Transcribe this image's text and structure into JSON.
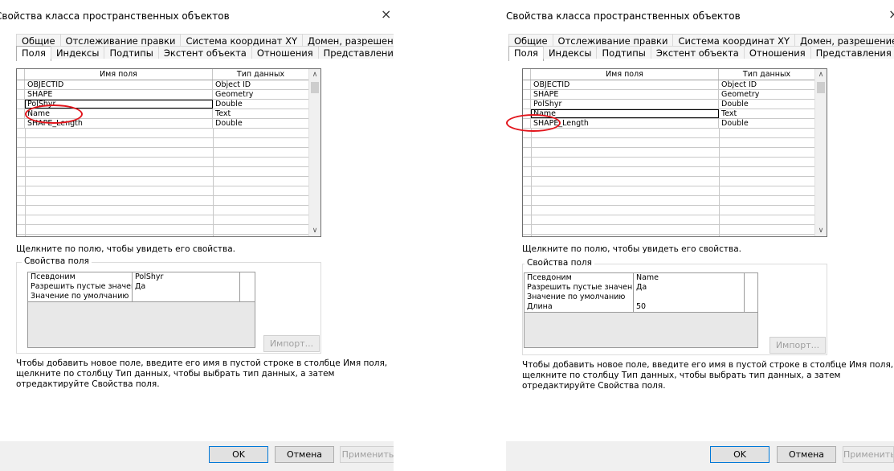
{
  "left": {
    "title": "Свойства класса пространственных объектов",
    "title_prefix_cut": "Свойства класса пространственных объектов",
    "close": "×",
    "tabs_row1": [
      "Общие",
      "Отслеживание правки",
      "Система координат XY",
      "Домен, разрешение и допуск"
    ],
    "tabs_row2": [
      "Поля",
      "Индексы",
      "Подтипы",
      "Экстент объекта",
      "Отношения",
      "Представления"
    ],
    "grid_headers": [
      "Имя поля",
      "Тип данных"
    ],
    "fields": [
      {
        "name": "OBJECTID",
        "type": "Object ID"
      },
      {
        "name": "SHAPE",
        "type": "Geometry"
      },
      {
        "name": "PolShyr",
        "type": "Double"
      },
      {
        "name": "Name",
        "type": "Text"
      },
      {
        "name": "SHAPE_Length",
        "type": "Double"
      }
    ],
    "hint": "Щелкните по полю, чтобы увидеть его свойства.",
    "group_label": "Свойства поля",
    "props": [
      {
        "k": "Псевдоним",
        "v": "PolShyr"
      },
      {
        "k": "Разрешить пустые значения",
        "v": "Да"
      },
      {
        "k": "Значение по умолчанию",
        "v": ""
      }
    ],
    "import_btn": "Импорт...",
    "instructions": [
      "Чтобы добавить новое поле, введите его имя в пустой строке в столбце Имя поля,",
      "щелкните по столбцу Тип данных, чтобы выбрать тип данных, а затем",
      "отредактируйте Свойства поля."
    ],
    "ok": "OK",
    "cancel": "Отмена",
    "apply": "Применить"
  },
  "right": {
    "title": "Свойства класса пространственных объектов",
    "close": "×",
    "tabs_row1": [
      "Общие",
      "Отслеживание правки",
      "Система координат XY",
      "Домен, разрешение и допуск"
    ],
    "tabs_row2": [
      "Поля",
      "Индексы",
      "Подтипы",
      "Экстент объекта",
      "Отношения",
      "Представления"
    ],
    "grid_headers": [
      "Имя поля",
      "Тип данных"
    ],
    "fields": [
      {
        "name": "OBJECTID",
        "type": "Object ID"
      },
      {
        "name": "SHAPE",
        "type": "Geometry"
      },
      {
        "name": "PolShyr",
        "type": "Double"
      },
      {
        "name": "Name",
        "type": "Text"
      },
      {
        "name": "SHAPE_Length",
        "type": "Double"
      }
    ],
    "hint": "Щелкните по полю, чтобы увидеть его свойства.",
    "group_label": "Свойства поля",
    "props": [
      {
        "k": "Псевдоним",
        "v": "Name"
      },
      {
        "k": "Разрешить пустые значения",
        "v": "Да"
      },
      {
        "k": "Значение по умолчанию",
        "v": ""
      },
      {
        "k": "Длина",
        "v": "50"
      }
    ],
    "import_btn": "Импорт...",
    "instructions": [
      "Чтобы добавить новое поле, введите его имя в пустой строке в столбце Имя поля,",
      "щелкните по столбцу Тип данных, чтобы выбрать тип данных, а затем",
      "отредактируйте Свойства поля."
    ],
    "ok": "OK",
    "cancel": "Отмена",
    "apply": "Применить"
  },
  "colors": {
    "annotation_ring": "#e2141b",
    "default_button_border": "#0078d7"
  }
}
